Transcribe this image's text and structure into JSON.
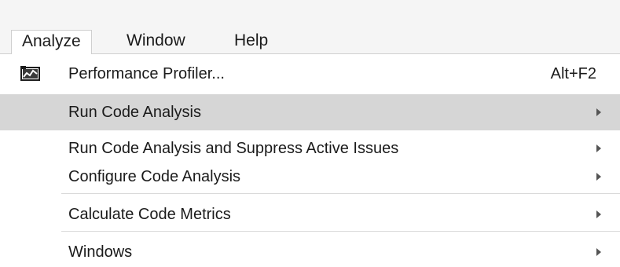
{
  "menubar": {
    "items": [
      {
        "label": "Analyze"
      },
      {
        "label": "Window"
      },
      {
        "label": "Help"
      }
    ]
  },
  "menu": {
    "items": [
      {
        "label": "Performance Profiler...",
        "shortcut": "Alt+F2",
        "icon": "performance-profiler-icon"
      },
      {
        "label": "Run Code Analysis",
        "submenu": true,
        "highlighted": true
      },
      {
        "label": "Run Code Analysis and Suppress Active Issues",
        "submenu": true
      },
      {
        "label": "Configure Code Analysis",
        "submenu": true
      },
      {
        "label": "Calculate Code Metrics",
        "submenu": true
      },
      {
        "label": "Windows",
        "submenu": true
      }
    ]
  },
  "colors": {
    "menubar_bg": "#f5f5f5",
    "highlight_bg": "#d6d6d6",
    "text": "#1b1b1b",
    "separator": "#d9d9d9"
  }
}
